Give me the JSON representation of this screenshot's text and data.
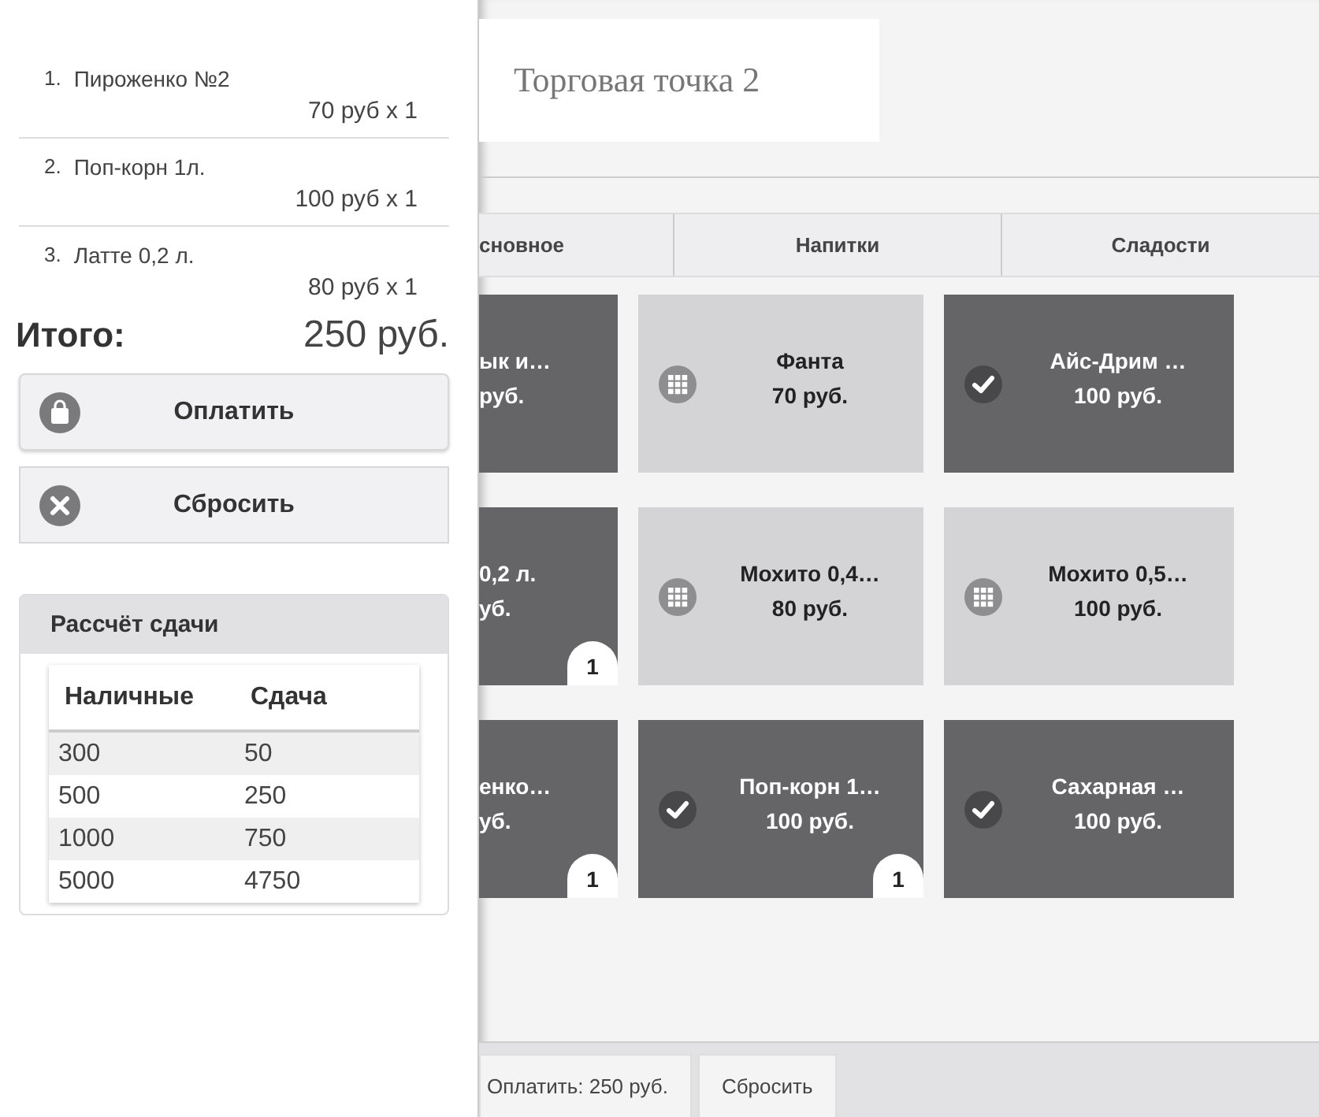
{
  "order": {
    "items": [
      {
        "number": "1.",
        "name": "Пироженко №2",
        "price": "70 руб x 1"
      },
      {
        "number": "2.",
        "name": "Поп-корн 1л.",
        "price": "100 руб x 1"
      },
      {
        "number": "3.",
        "name": "Латте 0,2 л.",
        "price": "80 руб x 1"
      }
    ],
    "total_label": "Итого:",
    "total": "250 руб.",
    "buttons": [
      {
        "kind": "pay",
        "label": "Оплатить"
      },
      {
        "kind": "reset",
        "label": "Сбросить"
      }
    ]
  },
  "change": {
    "title": "Рассчёт сдачи",
    "columns": [
      "Наличные",
      "Сдача"
    ],
    "rows": [
      [
        "300",
        "50"
      ],
      [
        "500",
        "250"
      ],
      [
        "1000",
        "750"
      ],
      [
        "5000",
        "4750"
      ]
    ]
  },
  "store": {
    "title": "Торговая точка 2"
  },
  "tabs": [
    "сновное",
    "Напитки",
    "Сладости"
  ],
  "tiles": [
    {
      "kind": "partial",
      "name": "ык и…",
      "price": "руб."
    },
    {
      "kind": "grid",
      "name": "Фанта",
      "price": "70 руб."
    },
    {
      "kind": "check",
      "name": "Айс-Дрим …",
      "price": "100 руб."
    },
    {
      "kind": "partial",
      "name": "0,2 л.",
      "price": "уб.",
      "badge": "1"
    },
    {
      "kind": "grid",
      "name": "Мохито 0,4…",
      "price": "80 руб."
    },
    {
      "kind": "grid",
      "name": "Мохито 0,5…",
      "price": "100 руб."
    },
    {
      "kind": "partial",
      "name": "енко…",
      "price": "уб.",
      "badge": "1"
    },
    {
      "kind": "check",
      "name": "Поп-корн 1…",
      "price": "100 руб.",
      "badge": "1"
    },
    {
      "kind": "check",
      "name": "Сахарная …",
      "price": "100 руб."
    }
  ],
  "footer": {
    "buttons": [
      "Оплатить: 250 руб.",
      "Сбросить"
    ]
  }
}
